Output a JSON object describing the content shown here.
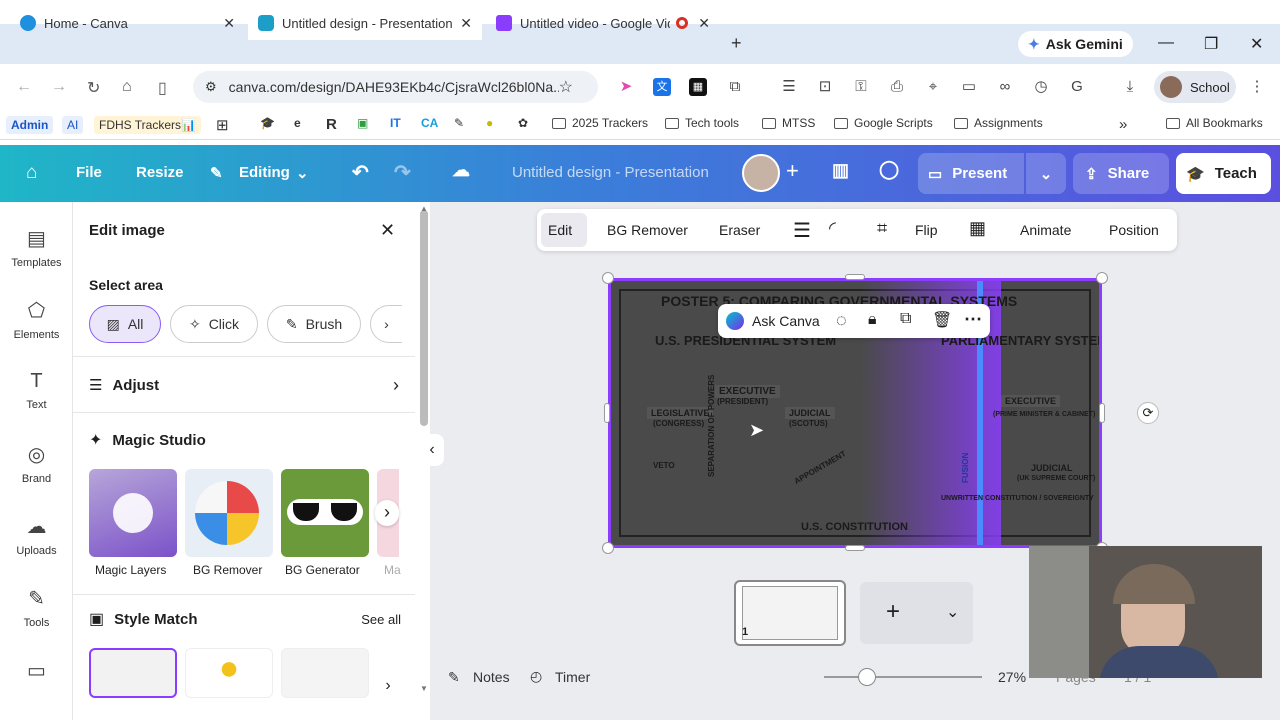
{
  "browser": {
    "tabs": [
      {
        "title": "Home - Canva",
        "active": false,
        "favicon_color": "#1f8fe0"
      },
      {
        "title": "Untitled design - Presentation",
        "active": true,
        "favicon_color": "#1c9ec9"
      },
      {
        "title": "Untitled video - Google Vid",
        "active": false,
        "favicon_color": "#8b3dff"
      }
    ],
    "gemini_label": "Ask Gemini",
    "url": "canva.com/design/DAHE93EKb4c/CjsraWcl26bl0Na...",
    "profile_label": "School",
    "bookmarks": [
      "Admin",
      "AI",
      "FDHS Trackers📊",
      "2025 Trackers",
      "Tech tools",
      "MTSS",
      "Google Scripts",
      "Assignments"
    ],
    "all_bookmarks": "All Bookmarks"
  },
  "canva_topbar": {
    "file": "File",
    "resize": "Resize",
    "editing": "Editing",
    "doc_title": "Untitled design - Presentation",
    "present": "Present",
    "share": "Share",
    "teach": "Teach"
  },
  "sidebar": [
    {
      "label": "Templates",
      "icon": "templates-icon"
    },
    {
      "label": "Elements",
      "icon": "elements-icon"
    },
    {
      "label": "Text",
      "icon": "text-icon"
    },
    {
      "label": "Brand",
      "icon": "brand-icon"
    },
    {
      "label": "Uploads",
      "icon": "uploads-icon"
    },
    {
      "label": "Tools",
      "icon": "tools-icon"
    }
  ],
  "panel": {
    "title": "Edit image",
    "select_area": "Select area",
    "chips": [
      "All",
      "Click",
      "Brush"
    ],
    "adjust": "Adjust",
    "magic_studio": "Magic Studio",
    "tools": [
      "Magic Layers",
      "BG Remover",
      "BG Generator",
      "Ma"
    ],
    "style_match": "Style Match",
    "see_all": "See all"
  },
  "edit_toolbar": [
    "Edit",
    "BG Remover",
    "Eraser",
    "Flip",
    "Animate",
    "Position"
  ],
  "poster": {
    "title": "POSTER 5: COMPARING GOVERNMENTAL SYSTEMS",
    "left_heading": "U.S. PRESIDENTIAL SYSTEM",
    "right_heading": "PARLIAMENTARY SYSTEM",
    "executive": "EXECUTIVE",
    "president": "(PRESIDENT)",
    "legislative": "LEGISLATIVE",
    "congress": "(CONGRESS)",
    "judicial": "JUDICIAL",
    "scotus": "(SCOTUS)",
    "separation": "SEPARATION OF POWERS",
    "veto": "VETO",
    "appointment": "APPOINTMENT",
    "constitution": "U.S. CONSTITUTION",
    "exec_right": "EXECUTIVE",
    "pm": "(PRIME MINISTER & CABINET)",
    "judicial_right": "JUDICIAL",
    "uk_court": "(UK SUPREME COURT)",
    "fusion": "FUSION",
    "unwritten": "UNWRITTEN CONSTITUTION / SOVEREIGNTY"
  },
  "ask_canva": "Ask Canva",
  "page_number": "1",
  "bottom": {
    "notes": "Notes",
    "timer": "Timer",
    "zoom": "27%",
    "pages": "Pages",
    "page_count": "1 / 1"
  }
}
